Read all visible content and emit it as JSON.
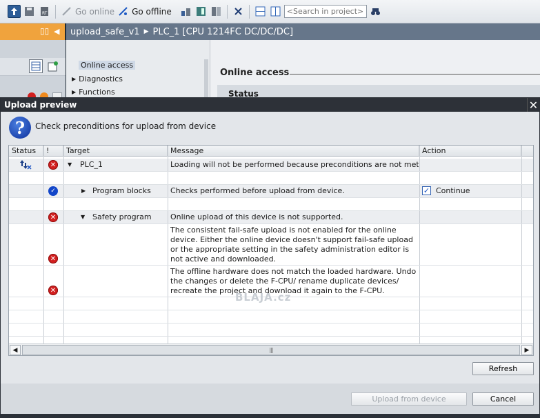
{
  "toolbar": {
    "go_online": "Go online",
    "go_offline": "Go offline",
    "search_placeholder": "<Search in project>"
  },
  "titlebar": {
    "project": "upload_safe_v1",
    "device": "PLC_1 [CPU 1214FC DC/DC/DC]"
  },
  "nav": {
    "items": [
      {
        "label": "Online access"
      },
      {
        "label": "Diagnostics"
      },
      {
        "label": "Functions"
      }
    ]
  },
  "main": {
    "title": "Online access",
    "status": "Status"
  },
  "dialog": {
    "title": "Upload preview",
    "instruction": "Check preconditions for upload from device",
    "columns": [
      "Status",
      "!",
      "Target",
      "Message",
      "Action"
    ],
    "rows": [
      {
        "target": "PLC_1",
        "message": "Loading will not be performed because preconditions are not met",
        "action": ""
      },
      {
        "target": "Program blocks",
        "message": "Checks performed before upload from device.",
        "action": "Continue"
      },
      {
        "target": "Safety program",
        "message": "Online upload of this device is not supported.",
        "action": ""
      },
      {
        "target": "",
        "message": "The consistent fail-safe upload is not enabled for the online device. Either the online device doesn't support fail-safe upload or the appropriate setting in the safety administration editor is not active and downloaded.",
        "action": ""
      },
      {
        "target": "",
        "message": "The offline hardware does not match the loaded hardware. Undo the changes or delete the F-CPU/ rename duplicate devices/ recreate the project and download it again to the F-CPU.",
        "action": ""
      }
    ],
    "refresh": "Refresh",
    "upload": "Upload from device",
    "cancel": "Cancel",
    "watermark": "BLAJA.cz"
  },
  "icons": {
    "error": "error-icon",
    "ok": "check-ok-icon",
    "question": "question-icon"
  },
  "colors": {
    "accent_orange": "#f0a33d",
    "title_dark": "#2d3138",
    "error_red": "#d21f1f",
    "ok_blue": "#1246c9"
  }
}
